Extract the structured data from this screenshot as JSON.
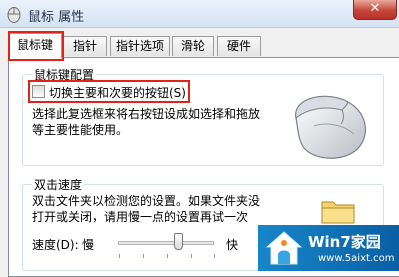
{
  "window": {
    "title": "鼠标 属性",
    "close_label": "✕"
  },
  "tabs": [
    {
      "label": "鼠标键",
      "active": true
    },
    {
      "label": "指针",
      "active": false
    },
    {
      "label": "指针选项",
      "active": false
    },
    {
      "label": "滑轮",
      "active": false
    },
    {
      "label": "硬件",
      "active": false
    }
  ],
  "button_config": {
    "title": "鼠标键配置",
    "checkbox_label": "切换主要和次要的按钮(S)",
    "checked": false,
    "description_line1": "选择此复选框来将右按钮设成如选择和拖放",
    "description_line2": "等主要性能使用。"
  },
  "double_click": {
    "title": "双击速度",
    "description_line1": "双击文件夹以检测您的设置。如果文件夹没",
    "description_line2": "打开或关闭，请用慢一点的设置再试一次",
    "speed_label": "速度(D):",
    "slow_label": "慢",
    "fast_label": "快",
    "speed_level": 0.6
  },
  "watermark": {
    "brand": "Win7家园",
    "url": "www.5aixt.com"
  },
  "colors": {
    "highlight": "#e2231a",
    "titlebar": "#d5e3f3",
    "watermark": "#1786c9"
  }
}
